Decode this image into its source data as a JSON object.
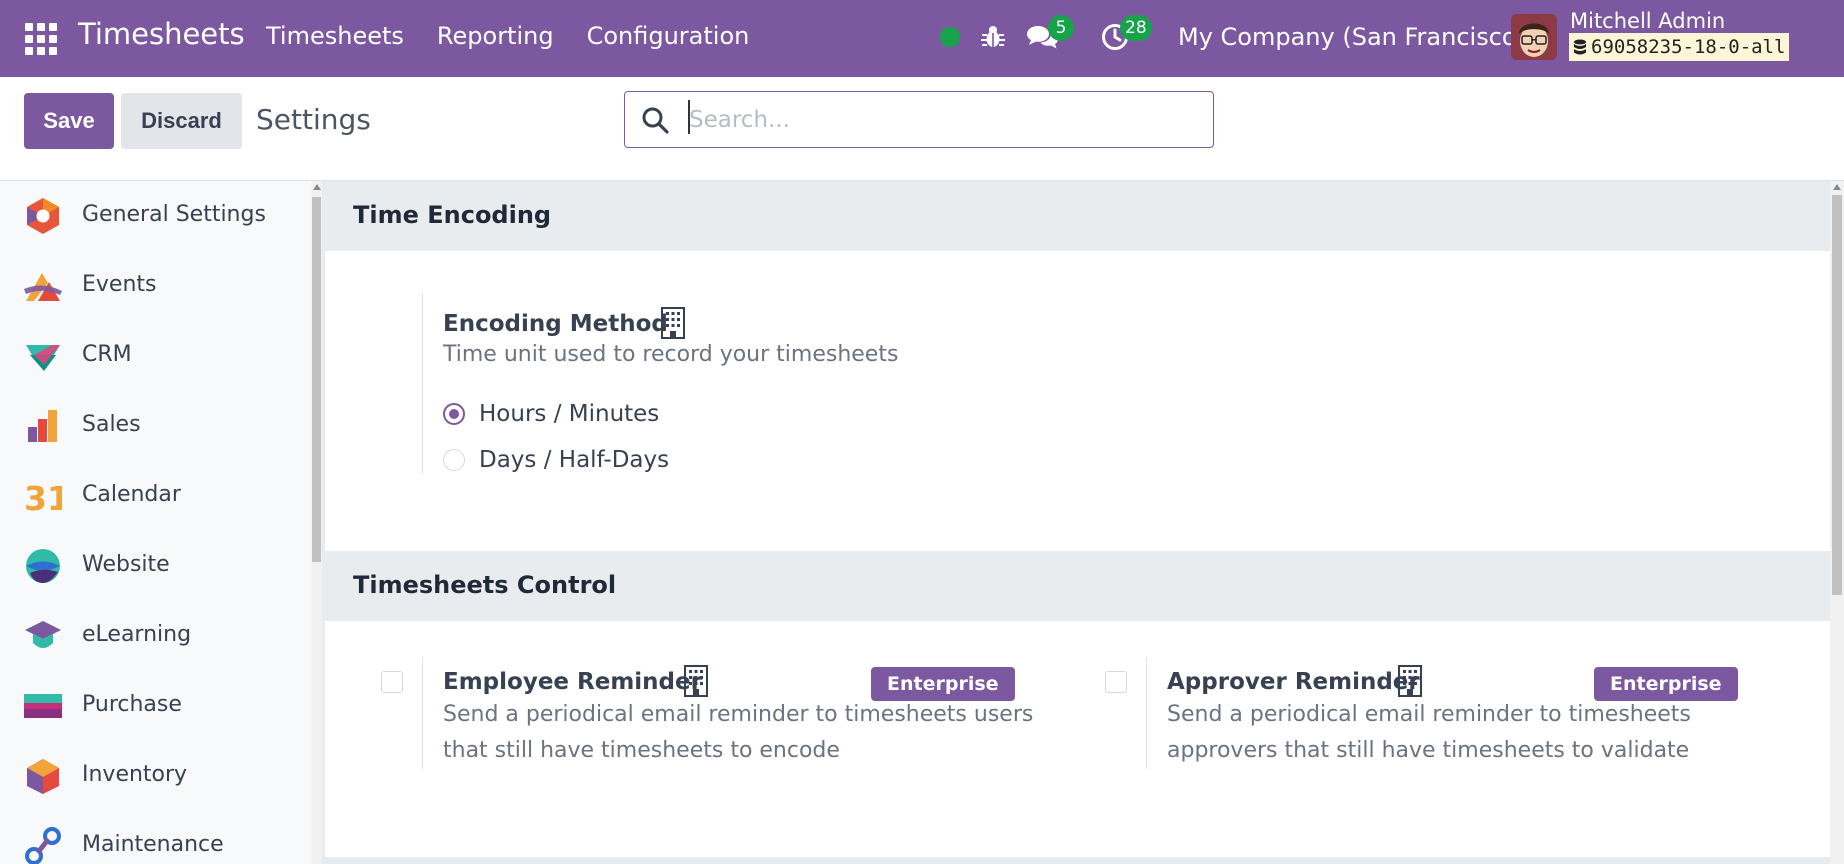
{
  "navbar": {
    "app_title": "Timesheets",
    "menu": [
      "Timesheets",
      "Reporting",
      "Configuration"
    ],
    "chat_count": "5",
    "activity_count": "28",
    "company": "My Company (San Francisco)",
    "user_name": "Mitchell Admin",
    "db_name": "69058235-18-0-all"
  },
  "control": {
    "save_label": "Save",
    "discard_label": "Discard",
    "title": "Settings",
    "search_placeholder": "Search..."
  },
  "sidebar": {
    "items": [
      {
        "label": "General Settings",
        "icon": "general-settings-icon"
      },
      {
        "label": "Events",
        "icon": "events-icon"
      },
      {
        "label": "CRM",
        "icon": "crm-icon"
      },
      {
        "label": "Sales",
        "icon": "sales-icon"
      },
      {
        "label": "Calendar",
        "icon": "calendar-icon",
        "glyph": "31"
      },
      {
        "label": "Website",
        "icon": "website-icon"
      },
      {
        "label": "eLearning",
        "icon": "elearning-icon"
      },
      {
        "label": "Purchase",
        "icon": "purchase-icon"
      },
      {
        "label": "Inventory",
        "icon": "inventory-icon"
      },
      {
        "label": "Maintenance",
        "icon": "maintenance-icon"
      }
    ]
  },
  "sections": {
    "time_encoding": {
      "title": "Time Encoding",
      "encoding_method": {
        "title": "Encoding Method",
        "description": "Time unit used to record your timesheets",
        "options": [
          "Hours / Minutes",
          "Days / Half-Days"
        ],
        "selected": "Hours / Minutes"
      }
    },
    "timesheets_control": {
      "title": "Timesheets Control",
      "employee_reminder": {
        "title": "Employee Reminder",
        "badge": "Enterprise",
        "desc_line1": "Send a periodical email reminder to timesheets users",
        "desc_line2": "that still have timesheets to encode",
        "checked": false
      },
      "approver_reminder": {
        "title": "Approver Reminder",
        "badge": "Enterprise",
        "desc_line1": "Send a periodical email reminder to timesheets",
        "desc_line2": "approvers that still have timesheets to validate",
        "checked": false
      }
    }
  },
  "colors": {
    "brand": "#7c58a0",
    "online": "#16a34a",
    "section_bg": "#e9ecef"
  }
}
